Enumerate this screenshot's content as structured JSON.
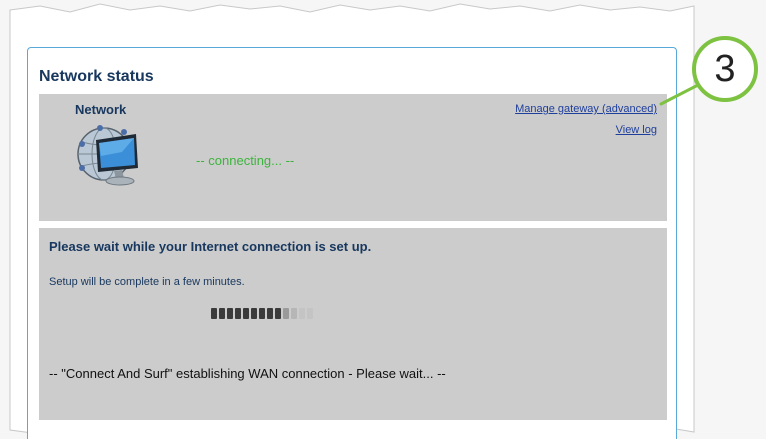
{
  "logo": {
    "text_gray": "…",
    "text_green": ""
  },
  "panel": {
    "title": "Network status"
  },
  "network": {
    "heading": "Network",
    "status": "-- connecting... --",
    "manage_link": "Manage gateway (advanced)",
    "view_log_link": "View log",
    "icon": "network-computer-icon"
  },
  "wait": {
    "heading": "Please wait while your Internet connection is set up.",
    "setup_text": "Setup will be complete in a few minutes.",
    "progress_segments_total": 13,
    "progress_segments_filled": 9,
    "wan_text": "-- \"Connect And Surf\" establishing WAN connection - Please wait... --"
  },
  "step_badge": {
    "number": "3"
  },
  "colors": {
    "panel_border": "#5aa8d8",
    "box_bg": "#cccccc",
    "heading": "#17375e",
    "status_green": "#3cb43c",
    "link": "#1f3f9c",
    "badge_ring": "#7ec242"
  }
}
